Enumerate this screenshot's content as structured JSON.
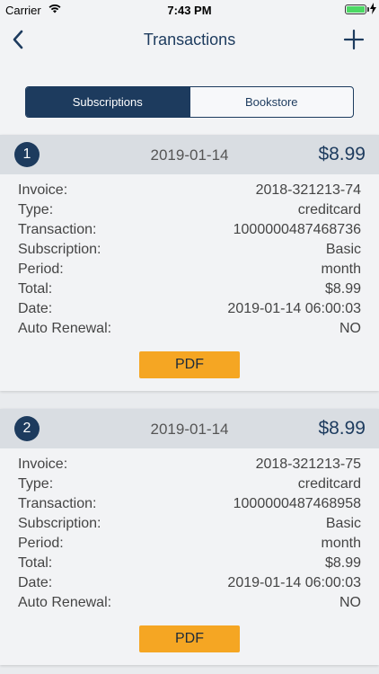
{
  "status_bar": {
    "carrier": "Carrier",
    "time": "7:43 PM"
  },
  "nav": {
    "title": "Transactions",
    "back_icon": "chevron-left-icon",
    "add_icon": "plus-icon"
  },
  "tabs": [
    {
      "label": "Subscriptions",
      "active": true
    },
    {
      "label": "Bookstore",
      "active": false
    }
  ],
  "labels": {
    "invoice": "Invoice:",
    "type": "Type:",
    "transaction": "Transaction:",
    "subscription": "Subscription:",
    "period": "Period:",
    "total": "Total:",
    "date": "Date:",
    "auto_renewal": "Auto Renewal:",
    "pdf": "PDF"
  },
  "transactions": [
    {
      "number": "1",
      "header_date": "2019-01-14",
      "amount": "$8.99",
      "invoice": "2018-321213-74",
      "type": "creditcard",
      "transaction": "1000000487468736",
      "subscription": "Basic",
      "period": "month",
      "total": "$8.99",
      "date": "2019-01-14 06:00:03",
      "auto_renewal": "NO"
    },
    {
      "number": "2",
      "header_date": "2019-01-14",
      "amount": "$8.99",
      "invoice": "2018-321213-75",
      "type": "creditcard",
      "transaction": "1000000487468958",
      "subscription": "Basic",
      "period": "month",
      "total": "$8.99",
      "date": "2019-01-14 06:00:03",
      "auto_renewal": "NO"
    }
  ],
  "colors": {
    "primary": "#1d3b5e",
    "accent": "#f5a623",
    "battery": "#4cd964"
  }
}
